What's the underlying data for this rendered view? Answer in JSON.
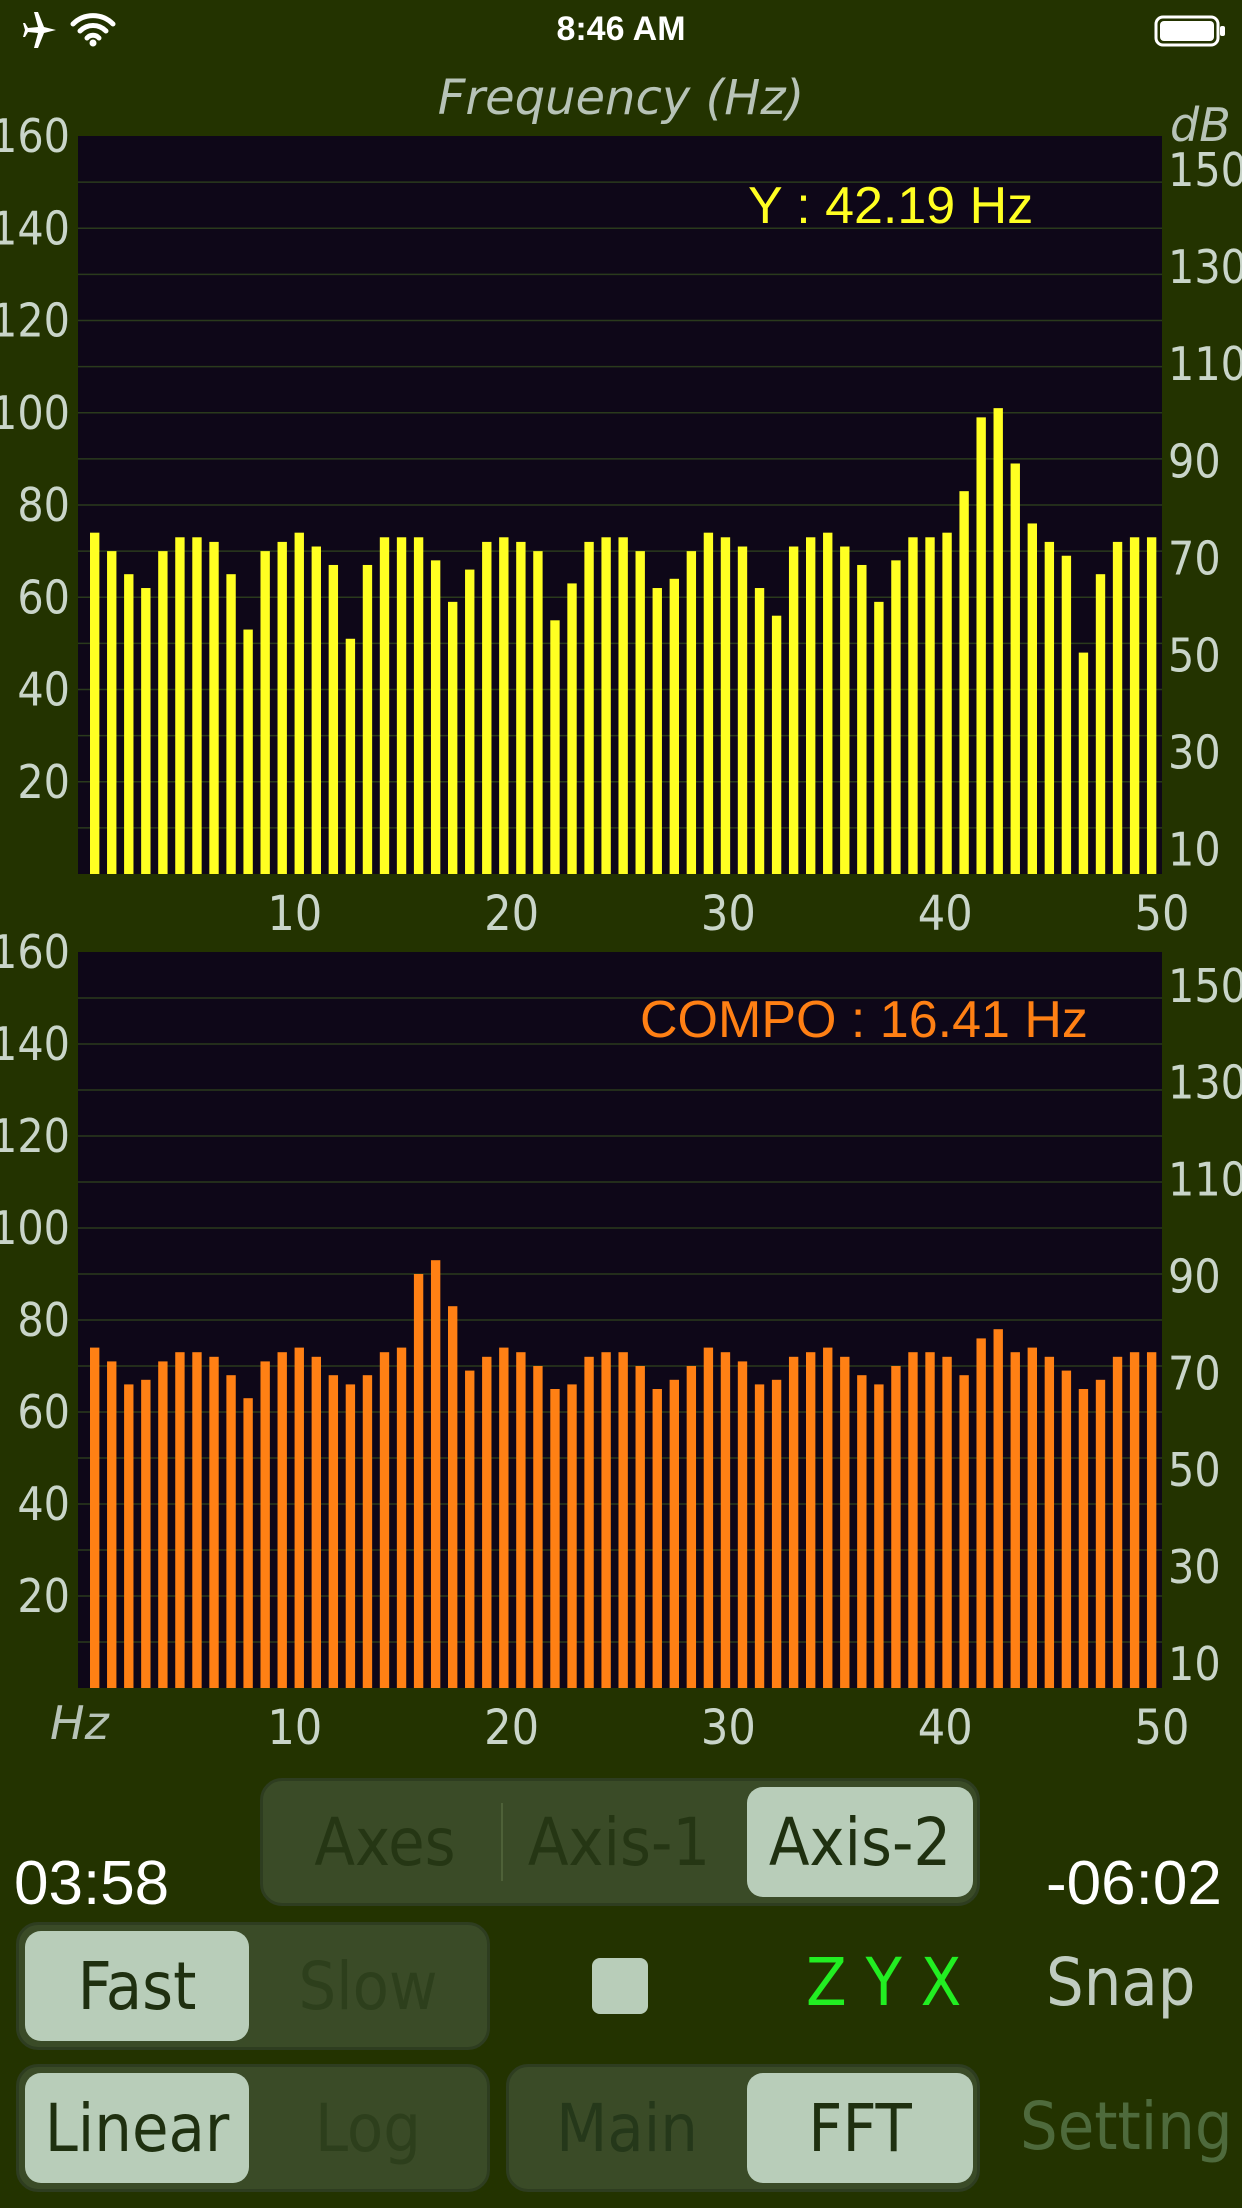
{
  "status_bar": {
    "time": "8:46 AM"
  },
  "chart_title": "Frequency (Hz)",
  "right_axis_unit": "dB",
  "x_axis_unit": "Hz",
  "colors": {
    "background": "#233300",
    "plot_bg": "#0e0718",
    "top_series": "#ffff22",
    "bottom_series": "#ff8014",
    "active_green": "#22ee22"
  },
  "chart_data": [
    {
      "type": "bar",
      "annotation": "Y : 42.19 Hz",
      "x_ticks": [
        10,
        20,
        30,
        40,
        50
      ],
      "y_left_ticks": [
        20,
        40,
        60,
        80,
        100,
        120,
        140,
        160
      ],
      "y_right_ticks": [
        10,
        30,
        50,
        70,
        90,
        110,
        130,
        150
      ],
      "ylim": [
        0,
        160
      ],
      "xlim": [
        0,
        50
      ],
      "bar_count": 50,
      "values": [
        74,
        70,
        65,
        62,
        70,
        73,
        73,
        72,
        65,
        53,
        70,
        72,
        74,
        71,
        67,
        51,
        67,
        73,
        73,
        73,
        68,
        59,
        66,
        72,
        73,
        72,
        70,
        55,
        63,
        72,
        73,
        73,
        70,
        62,
        64,
        70,
        74,
        73,
        71,
        62,
        56,
        71,
        73,
        74,
        71,
        67,
        59,
        68,
        73,
        73,
        74,
        83,
        99,
        101,
        89,
        76,
        72,
        69,
        48,
        65,
        72,
        73,
        73
      ]
    },
    {
      "type": "bar",
      "annotation": "COMPO : 16.41 Hz",
      "x_ticks": [
        10,
        20,
        30,
        40,
        50
      ],
      "y_left_ticks": [
        20,
        40,
        60,
        80,
        100,
        120,
        140,
        160
      ],
      "y_right_ticks": [
        10,
        30,
        50,
        70,
        90,
        110,
        130,
        150
      ],
      "ylim": [
        0,
        160
      ],
      "xlim": [
        0,
        50
      ],
      "bar_count": 50,
      "values": [
        74,
        71,
        66,
        67,
        71,
        73,
        73,
        72,
        68,
        63,
        71,
        73,
        74,
        72,
        68,
        66,
        68,
        73,
        74,
        90,
        93,
        83,
        69,
        72,
        74,
        73,
        70,
        65,
        66,
        72,
        73,
        73,
        70,
        65,
        67,
        70,
        74,
        73,
        71,
        66,
        67,
        72,
        73,
        74,
        72,
        68,
        66,
        70,
        73,
        73,
        72,
        68,
        76,
        78,
        73,
        74,
        72,
        69,
        65,
        67,
        72,
        73,
        73
      ]
    }
  ],
  "time_elapsed": "03:58",
  "time_remaining": "-06:02",
  "axis_tabs": [
    {
      "label": "Axes",
      "active": false
    },
    {
      "label": "Axis-1",
      "active": false
    },
    {
      "label": "Axis-2",
      "active": true
    }
  ],
  "speed_tabs": [
    {
      "label": "Fast",
      "active": true
    },
    {
      "label": "Slow",
      "active": false
    }
  ],
  "axes_order_label": "Z Y X",
  "snap_label": "Snap",
  "scale_tabs": [
    {
      "label": "Linear",
      "active": true
    },
    {
      "label": "Log",
      "active": false
    }
  ],
  "view_tabs": [
    {
      "label": "Main",
      "active": false
    },
    {
      "label": "FFT",
      "active": true
    }
  ],
  "setting_label": "Setting"
}
